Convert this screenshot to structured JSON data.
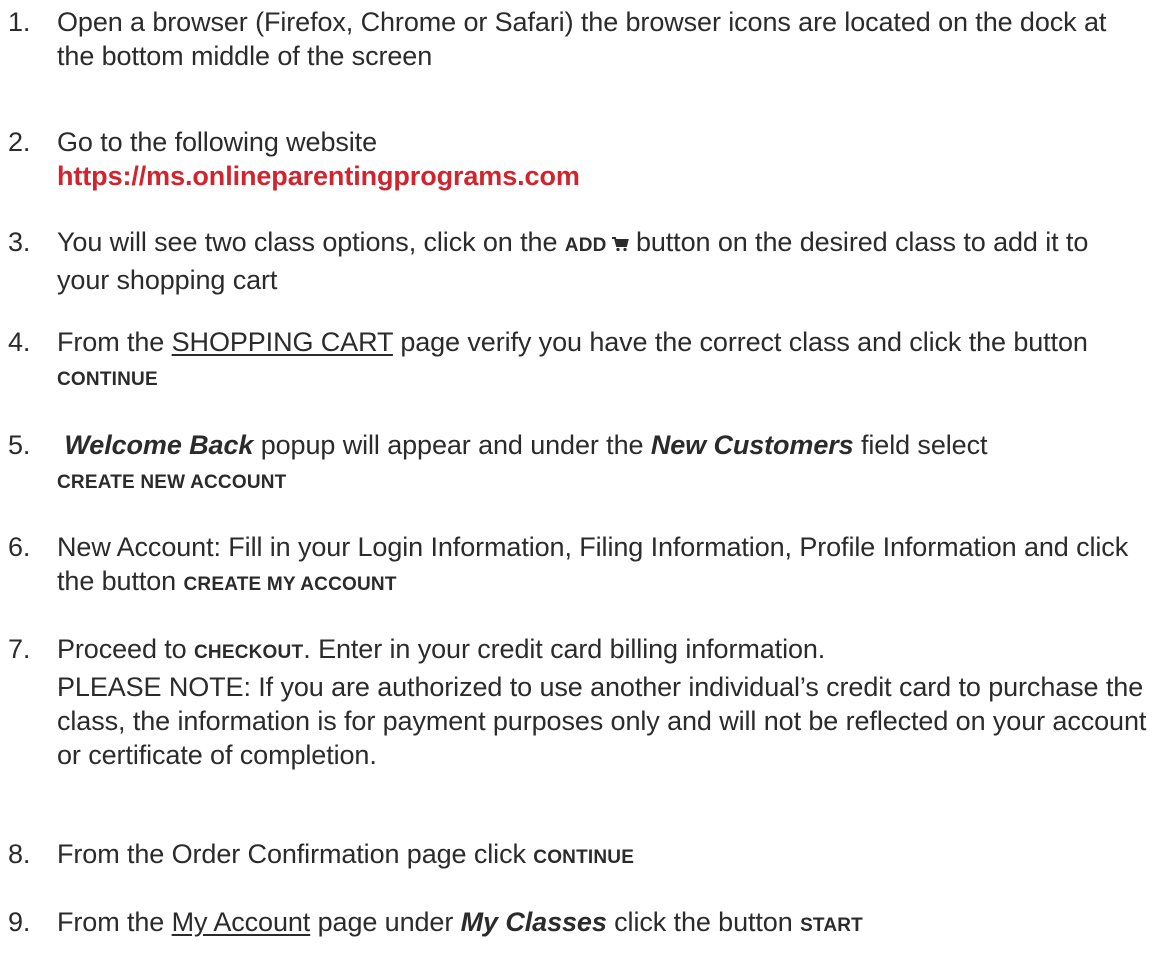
{
  "steps": [
    {
      "num": "1.",
      "text": "Open a browser (Firefox, Chrome or Safari) the browser icons are located on the dock at the bottom middle of the screen"
    },
    {
      "num": "2.",
      "text": "Go to the following website",
      "url": "https://ms.onlineparentingprograms.com"
    },
    {
      "num": "3.",
      "pre": "You will see two class options, click on the",
      "button": "ADD",
      "icon": "shopping-cart-icon",
      "post": "button on the desired class to add it to your shopping cart"
    },
    {
      "num": "4.",
      "pre": "From the",
      "link": "SHOPPING CART",
      "mid": "page verify you have the correct class and click the button",
      "button": "CONTINUE"
    },
    {
      "num": "5.",
      "em1": "Welcome Back",
      "mid": "popup will appear and under the",
      "em2": "New Customers",
      "post": "field select",
      "button": "CREATE NEW ACCOUNT"
    },
    {
      "num": "6.",
      "text": "New Account: Fill in your Login Information, Filing Information, Profile Information and click the button",
      "button": "CREATE MY ACCOUNT"
    },
    {
      "num": "7.",
      "pre": "Proceed to",
      "button": "CHECKOUT",
      "post": ". Enter in your credit card billing information.",
      "note": "PLEASE NOTE: If you are authorized to use another individual’s credit card to purchase the class, the information is for payment purposes only and will not be reflected on your account or certificate of completion."
    },
    {
      "num": "8.",
      "text": "From the Order Confirmation page click",
      "button": "CONTINUE"
    },
    {
      "num": "9.",
      "pre": "From the",
      "link": "My Account",
      "mid": "page under",
      "em": "My Classes",
      "post": "click the button",
      "button": "START"
    }
  ],
  "colors": {
    "text": "#2b2b2b",
    "url": "#d0242e"
  }
}
